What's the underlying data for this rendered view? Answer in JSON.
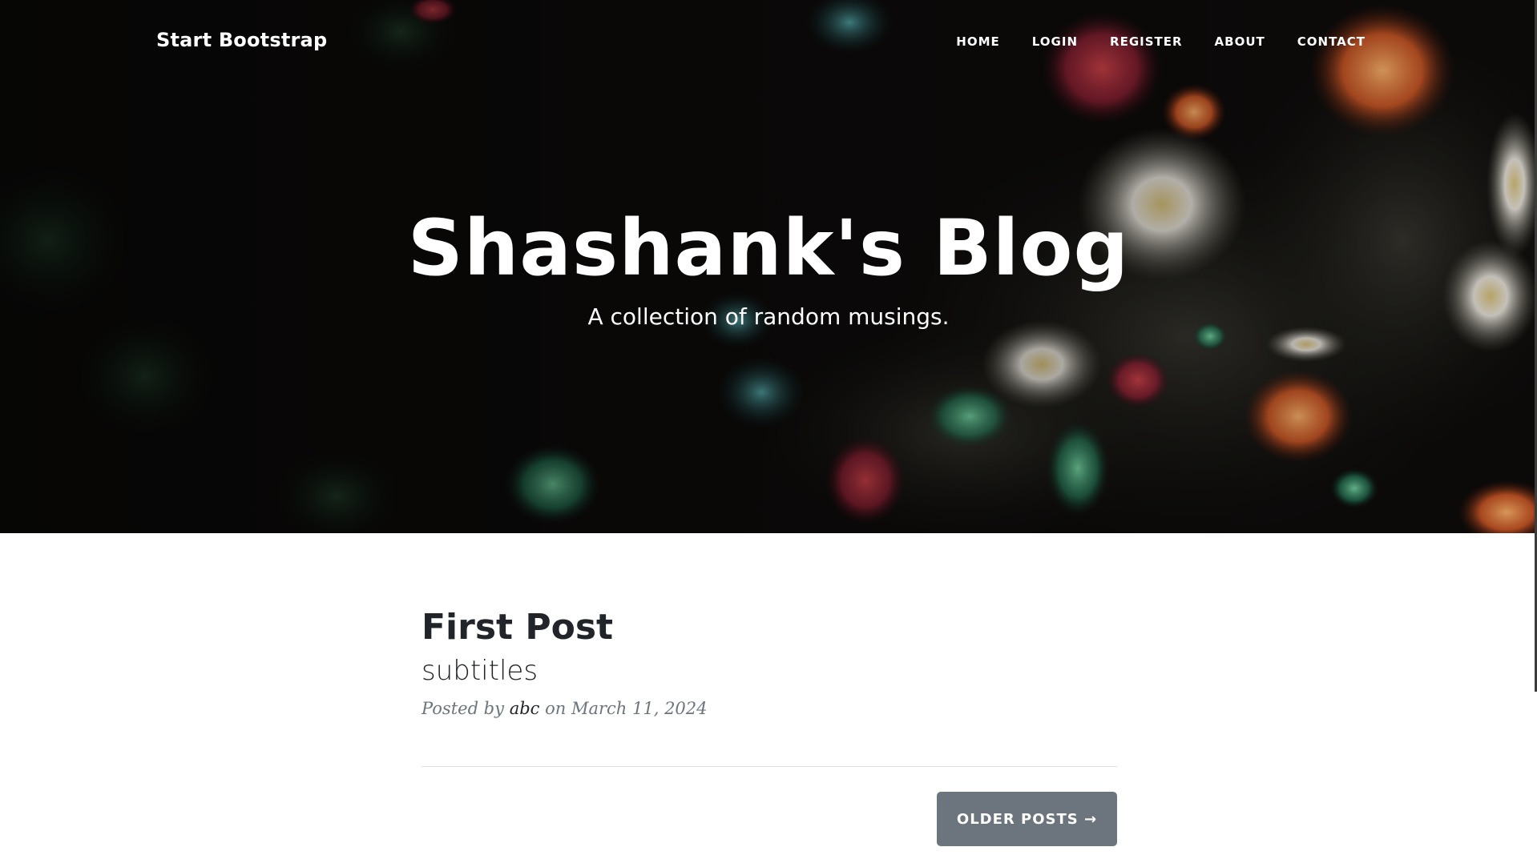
{
  "navbar": {
    "brand": "Start Bootstrap",
    "links": [
      {
        "label": "Home"
      },
      {
        "label": "Login"
      },
      {
        "label": "Register"
      },
      {
        "label": "About"
      },
      {
        "label": "Contact"
      }
    ]
  },
  "masthead": {
    "title": "Shashank's Blog",
    "subtitle": "A collection of random musings.",
    "background": "aquarium-sea-anemones-photo"
  },
  "posts": [
    {
      "title": "First Post",
      "subtitle": "subtitles",
      "meta_prefix": "Posted by",
      "author": "abc",
      "meta_on": "on",
      "date": "March 11, 2024"
    }
  ],
  "pager": {
    "older_label": "Older Posts →"
  },
  "colors": {
    "text_dark": "#212529",
    "muted": "#6c757d",
    "button_bg": "#6c757d",
    "divider": "#dee2e6"
  }
}
